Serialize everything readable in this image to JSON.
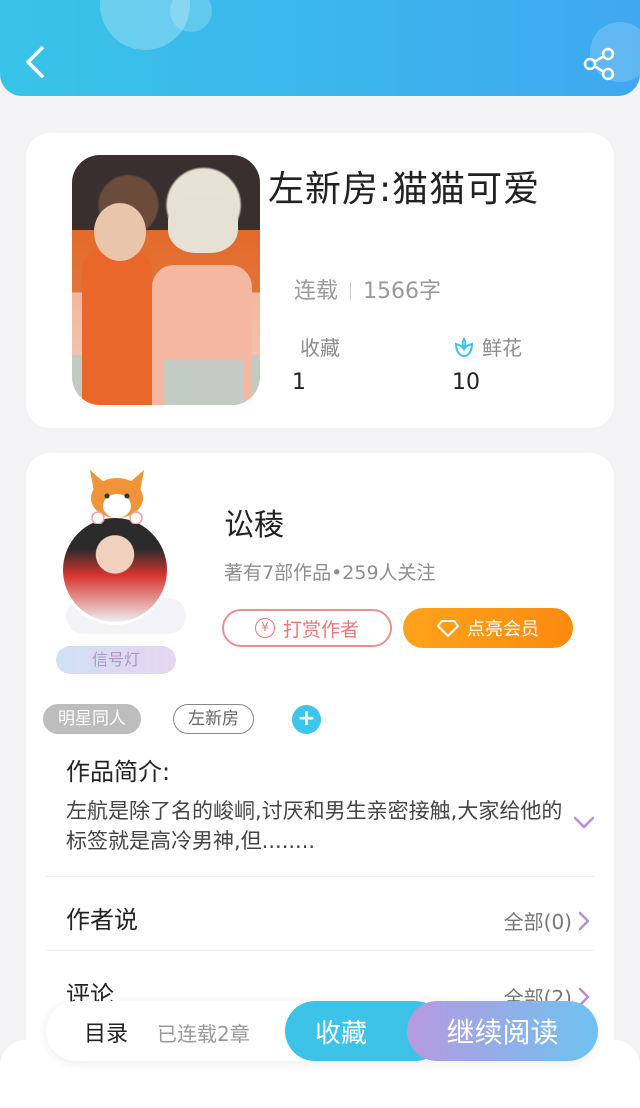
{
  "book": {
    "title": "左新房:猫猫可爱",
    "status": "连载",
    "word_count": "1566字",
    "favorites_label": "收藏",
    "favorites_value": "1",
    "flowers_label": "鲜花",
    "flowers_value": "10"
  },
  "author": {
    "name": "讼稜",
    "stats": "著有7部作品•259人关注",
    "badge": "信号灯",
    "tip_label": "打赏作者",
    "vip_label": "点亮会员"
  },
  "tags": [
    "明星同人",
    "左新房"
  ],
  "intro": {
    "title": "作品简介:",
    "text": "左航是除了名的峻峒,讨厌和男生亲密接触,大家给他的标签就是高冷男神,但........"
  },
  "author_says": {
    "title": "作者说",
    "right": "全部(0)"
  },
  "comments": {
    "title": "评论",
    "right": "全部(2)"
  },
  "bottom": {
    "toc": "目录",
    "chapters": "已连载2章",
    "favorite": "收藏",
    "continue": "继续阅读"
  },
  "colors": {
    "header": "#3fb6ee",
    "accent": "#3dc2e8",
    "vip": "#ffa31a",
    "tip": "#ef7777"
  }
}
